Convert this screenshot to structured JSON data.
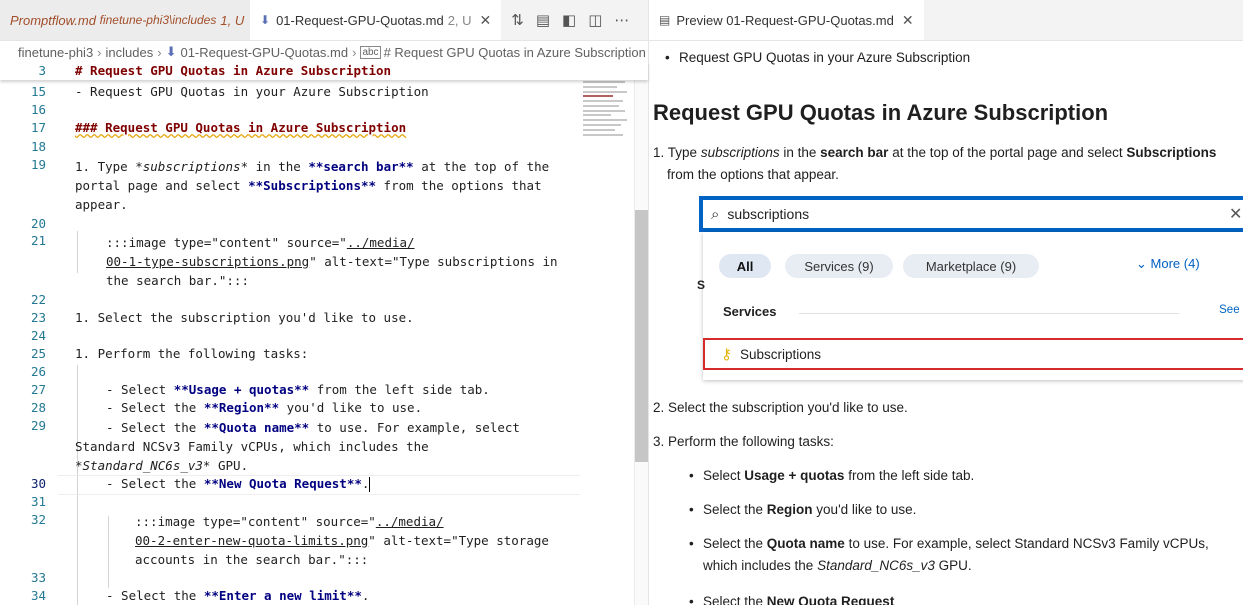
{
  "editor": {
    "tabs": [
      {
        "name": "Promptflow.md",
        "path": "finetune-phi3\\includes",
        "status": "1, U"
      },
      {
        "name": "01-Request-GPU-Quotas.md",
        "status": "2, U"
      }
    ],
    "breadcrumb": [
      "finetune-phi3",
      "includes",
      "01-Request-GPU-Quotas.md",
      "# Request GPU Quotas in Azure Subscription"
    ],
    "lines": [
      {
        "n": "3",
        "text": "# Request GPU Quotas in Azure Subscription"
      },
      {
        "n": "15",
        "text": "- Request GPU Quotas in your Azure Subscription"
      },
      {
        "n": "16",
        "text": ""
      },
      {
        "n": "17",
        "text": "### Request GPU Quotas in Azure Subscription"
      },
      {
        "n": "18",
        "text": ""
      },
      {
        "n": "19a",
        "text": "1. Type "
      },
      {
        "n": "20",
        "text": ""
      },
      {
        "n": "22",
        "text": ""
      },
      {
        "n": "23",
        "text": "1. Select the subscription you'd like to use."
      },
      {
        "n": "24",
        "text": ""
      },
      {
        "n": "25",
        "text": "1. Perform the following tasks:"
      },
      {
        "n": "26",
        "text": ""
      }
    ],
    "line19": {
      "pre": "1. Type ",
      "italic": "*subscriptions*",
      "mid": " in the ",
      "bold1": "**search bar**",
      "post": " at the top of the",
      "l2pre": "portal page and select ",
      "bold2": "**Subscriptions**",
      "l2post": " from the options that",
      "l3": "appear."
    },
    "line21": {
      "pre": ":::image type=\"content\" source=\"",
      "link1": "../media/",
      "l2link": "00-1-type-subscriptions.png",
      "l2post": "\" alt-text=\"Type subscriptions in",
      "l3": "the search bar.\":::"
    },
    "line27": {
      "pre": "- Select ",
      "bold": "**Usage + quotas**",
      "post": " from the left side tab."
    },
    "line28": {
      "pre": "- Select the ",
      "bold": "**Region**",
      "post": " you'd like to use."
    },
    "line29": {
      "pre": "- Select the ",
      "bold": "**Quota name**",
      "post": " to use. For example, select",
      "l2": "Standard NCSv3 Family vCPUs, which includes the",
      "l3ital": "*Standard_NC6s_v3*",
      "l3post": " GPU."
    },
    "line30": {
      "pre": "- Select the ",
      "bold": "**New Quota Request**",
      "post": "."
    },
    "line32": {
      "pre": ":::image type=\"content\" source=\"",
      "link1": "../media/",
      "l2link": "00-2-enter-new-quota-limits.png",
      "l2post": "\" alt-text=\"Type storage",
      "l3": "accounts in the search bar.\":::"
    },
    "line34": {
      "pre": "- Select the ",
      "bold": "**Enter a new limit**",
      "post": "."
    },
    "nums": {
      "n3": "3",
      "n15": "15",
      "n16": "16",
      "n17": "17",
      "n18": "18",
      "n19": "19",
      "n20": "20",
      "n21": "21",
      "n22": "22",
      "n23": "23",
      "n24": "24",
      "n25": "25",
      "n26": "26",
      "n27": "27",
      "n28": "28",
      "n29": "29",
      "n30": "30",
      "n31": "31",
      "n32": "32",
      "n33": "33",
      "n34": "34"
    }
  },
  "preview": {
    "tab": "Preview 01-Request-GPU-Quotas.md",
    "bullet0": "Request GPU Quotas in your Azure Subscription",
    "heading": "Request GPU Quotas in Azure Subscription",
    "step1": {
      "n": "1.",
      "pre": "Type ",
      "ital": "subscriptions",
      "mid": " in the ",
      "bold1": "search bar",
      "post": " at the top of the portal page and select ",
      "bold2": "Subscriptions",
      "l2": "from the options that appear."
    },
    "shot": {
      "search_value": "subscriptions",
      "pills": [
        "All",
        "Services (9)",
        "Marketplace (9)"
      ],
      "more": "More (4)",
      "services_label": "Services",
      "see_more": "See more",
      "result": "Subscriptions",
      "stray": "S"
    },
    "step2": {
      "n": "2.",
      "text": "Select the subscription you'd like to use."
    },
    "step3": {
      "n": "3.",
      "text": "Perform the following tasks:"
    },
    "sub1": {
      "pre": "Select ",
      "bold": "Usage + quotas",
      "post": " from the left side tab."
    },
    "sub2": {
      "pre": "Select the ",
      "bold": "Region",
      "post": " you'd like to use."
    },
    "sub3": {
      "pre": "Select the ",
      "bold": "Quota name",
      "post": " to use. For example, select Standard NCSv3 Family vCPUs,",
      "l2pre": "which includes the ",
      "l2ital": "Standard_NC6s_v3",
      "l2post": " GPU."
    },
    "sub4": {
      "pre": "Select the ",
      "bold": "New Quota Request"
    }
  }
}
